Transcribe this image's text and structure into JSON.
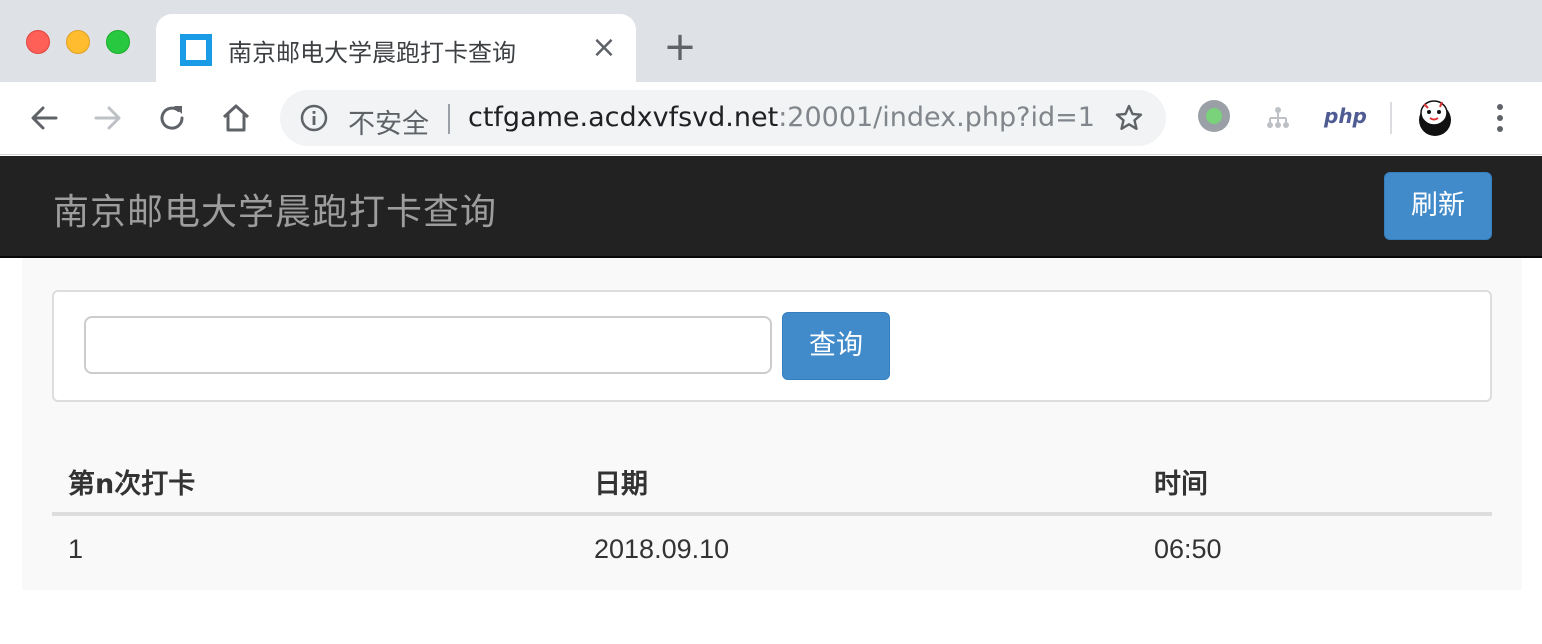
{
  "browser": {
    "tab_title": "南京邮电大学晨跑打卡查询",
    "tab_close": "×",
    "new_tab": "+",
    "security_label": "不安全",
    "url_host": "ctfgame.acdxvfsvd.net",
    "url_rest": ":20001/index.php?id=1",
    "extensions": {
      "php_label": "php"
    }
  },
  "page": {
    "brand": "南京邮电大学晨跑打卡查询",
    "refresh_button": "刷新",
    "search": {
      "input_value": "",
      "placeholder": "",
      "button_label": "查询"
    },
    "table": {
      "headers": [
        "第n次打卡",
        "日期",
        "时间"
      ],
      "rows": [
        [
          "1",
          "2018.09.10",
          "06:50"
        ]
      ]
    }
  },
  "colors": {
    "navbar_bg": "#222222",
    "brand_text": "#9d9d9d",
    "primary_button": "#428bca"
  }
}
